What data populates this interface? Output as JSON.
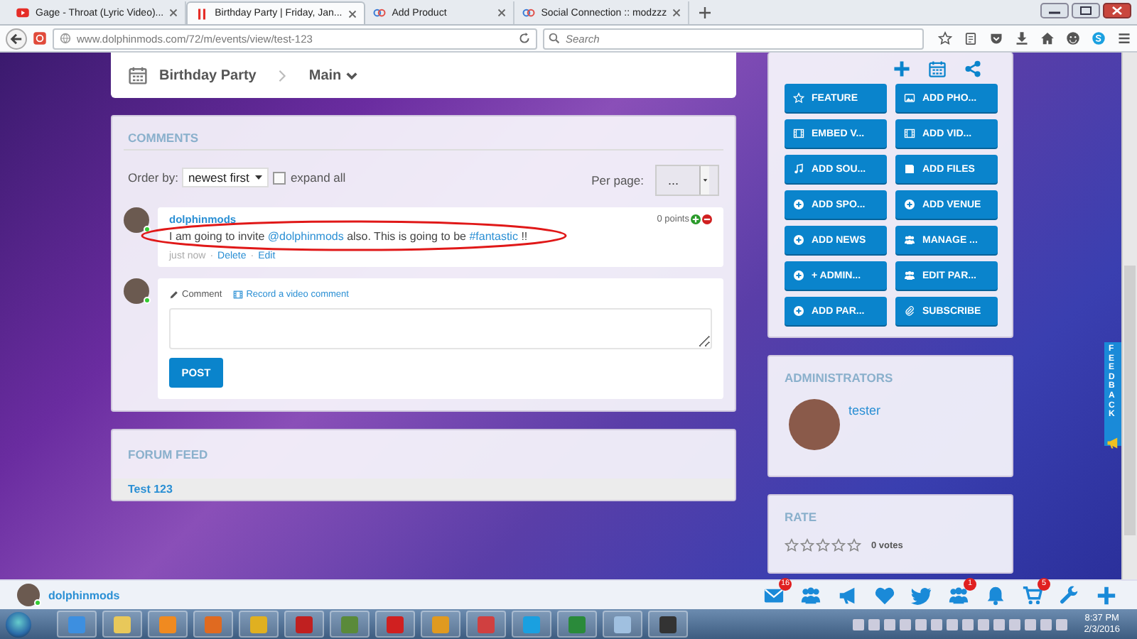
{
  "browser": {
    "tabs": [
      {
        "title": "Gage - Throat (Lyric Video)...",
        "selected": false
      },
      {
        "title": "Birthday Party | Friday, Jan...",
        "selected": true
      },
      {
        "title": "Add Product",
        "selected": false
      },
      {
        "title": "Social Connection :: modzzz",
        "selected": false
      }
    ],
    "url": "www.dolphinmods.com/72/m/events/view/test-123",
    "search": {
      "placeholder": "Search"
    }
  },
  "header": {
    "title": "Birthday Party",
    "section": "Main"
  },
  "comments": {
    "title": "COMMENTS",
    "order_label": "Order by:",
    "order_value": "newest first",
    "expand": {
      "label": "expand all",
      "checked": false
    },
    "per_page_label": "Per page:",
    "per_page_value": "...",
    "items": [
      {
        "author": "dolphinmods",
        "points": "0 points",
        "body": [
          {
            "kind": "text",
            "text": "I am going to invite "
          },
          {
            "kind": "link",
            "text": "@dolphinmods"
          },
          {
            "kind": "text",
            "text": " also. This is going to be "
          },
          {
            "kind": "link",
            "text": "#fantastic"
          },
          {
            "kind": "text",
            "text": " !!"
          }
        ],
        "meta": [
          {
            "kind": "time",
            "text": "just now"
          },
          {
            "kind": "sep",
            "text": "·"
          },
          {
            "kind": "link",
            "text": "Delete"
          },
          {
            "kind": "sep",
            "text": "·"
          },
          {
            "kind": "link",
            "text": "Edit"
          }
        ]
      }
    ],
    "composer": {
      "tabs": [
        "Comment",
        "Record a video comment"
      ],
      "button": "POST"
    }
  },
  "forum_feed": {
    "title": "FORUM FEED",
    "items": [
      "Test 123"
    ]
  },
  "actions": [
    "FEATURE",
    "ADD PHO...",
    "EMBED V...",
    "ADD VID...",
    "ADD SOU...",
    "ADD FILES",
    "ADD SPO...",
    "ADD VENUE",
    "ADD NEWS",
    "MANAGE ...",
    "+ ADMIN...",
    "EDIT PAR...",
    "ADD PAR...",
    "SUBSCRIBE"
  ],
  "administrators": {
    "title": "ADMINISTRATORS",
    "items": [
      {
        "name": "tester"
      }
    ]
  },
  "rate": {
    "title": "RATE",
    "stars": 0,
    "votes": "0 votes"
  },
  "feedback": "FEEDBACK",
  "user_bar": {
    "name": "dolphinmods",
    "badges": [
      "16",
      "1",
      "5"
    ]
  },
  "taskbar": {
    "time": "8:37 PM",
    "date": "2/3/2016"
  }
}
